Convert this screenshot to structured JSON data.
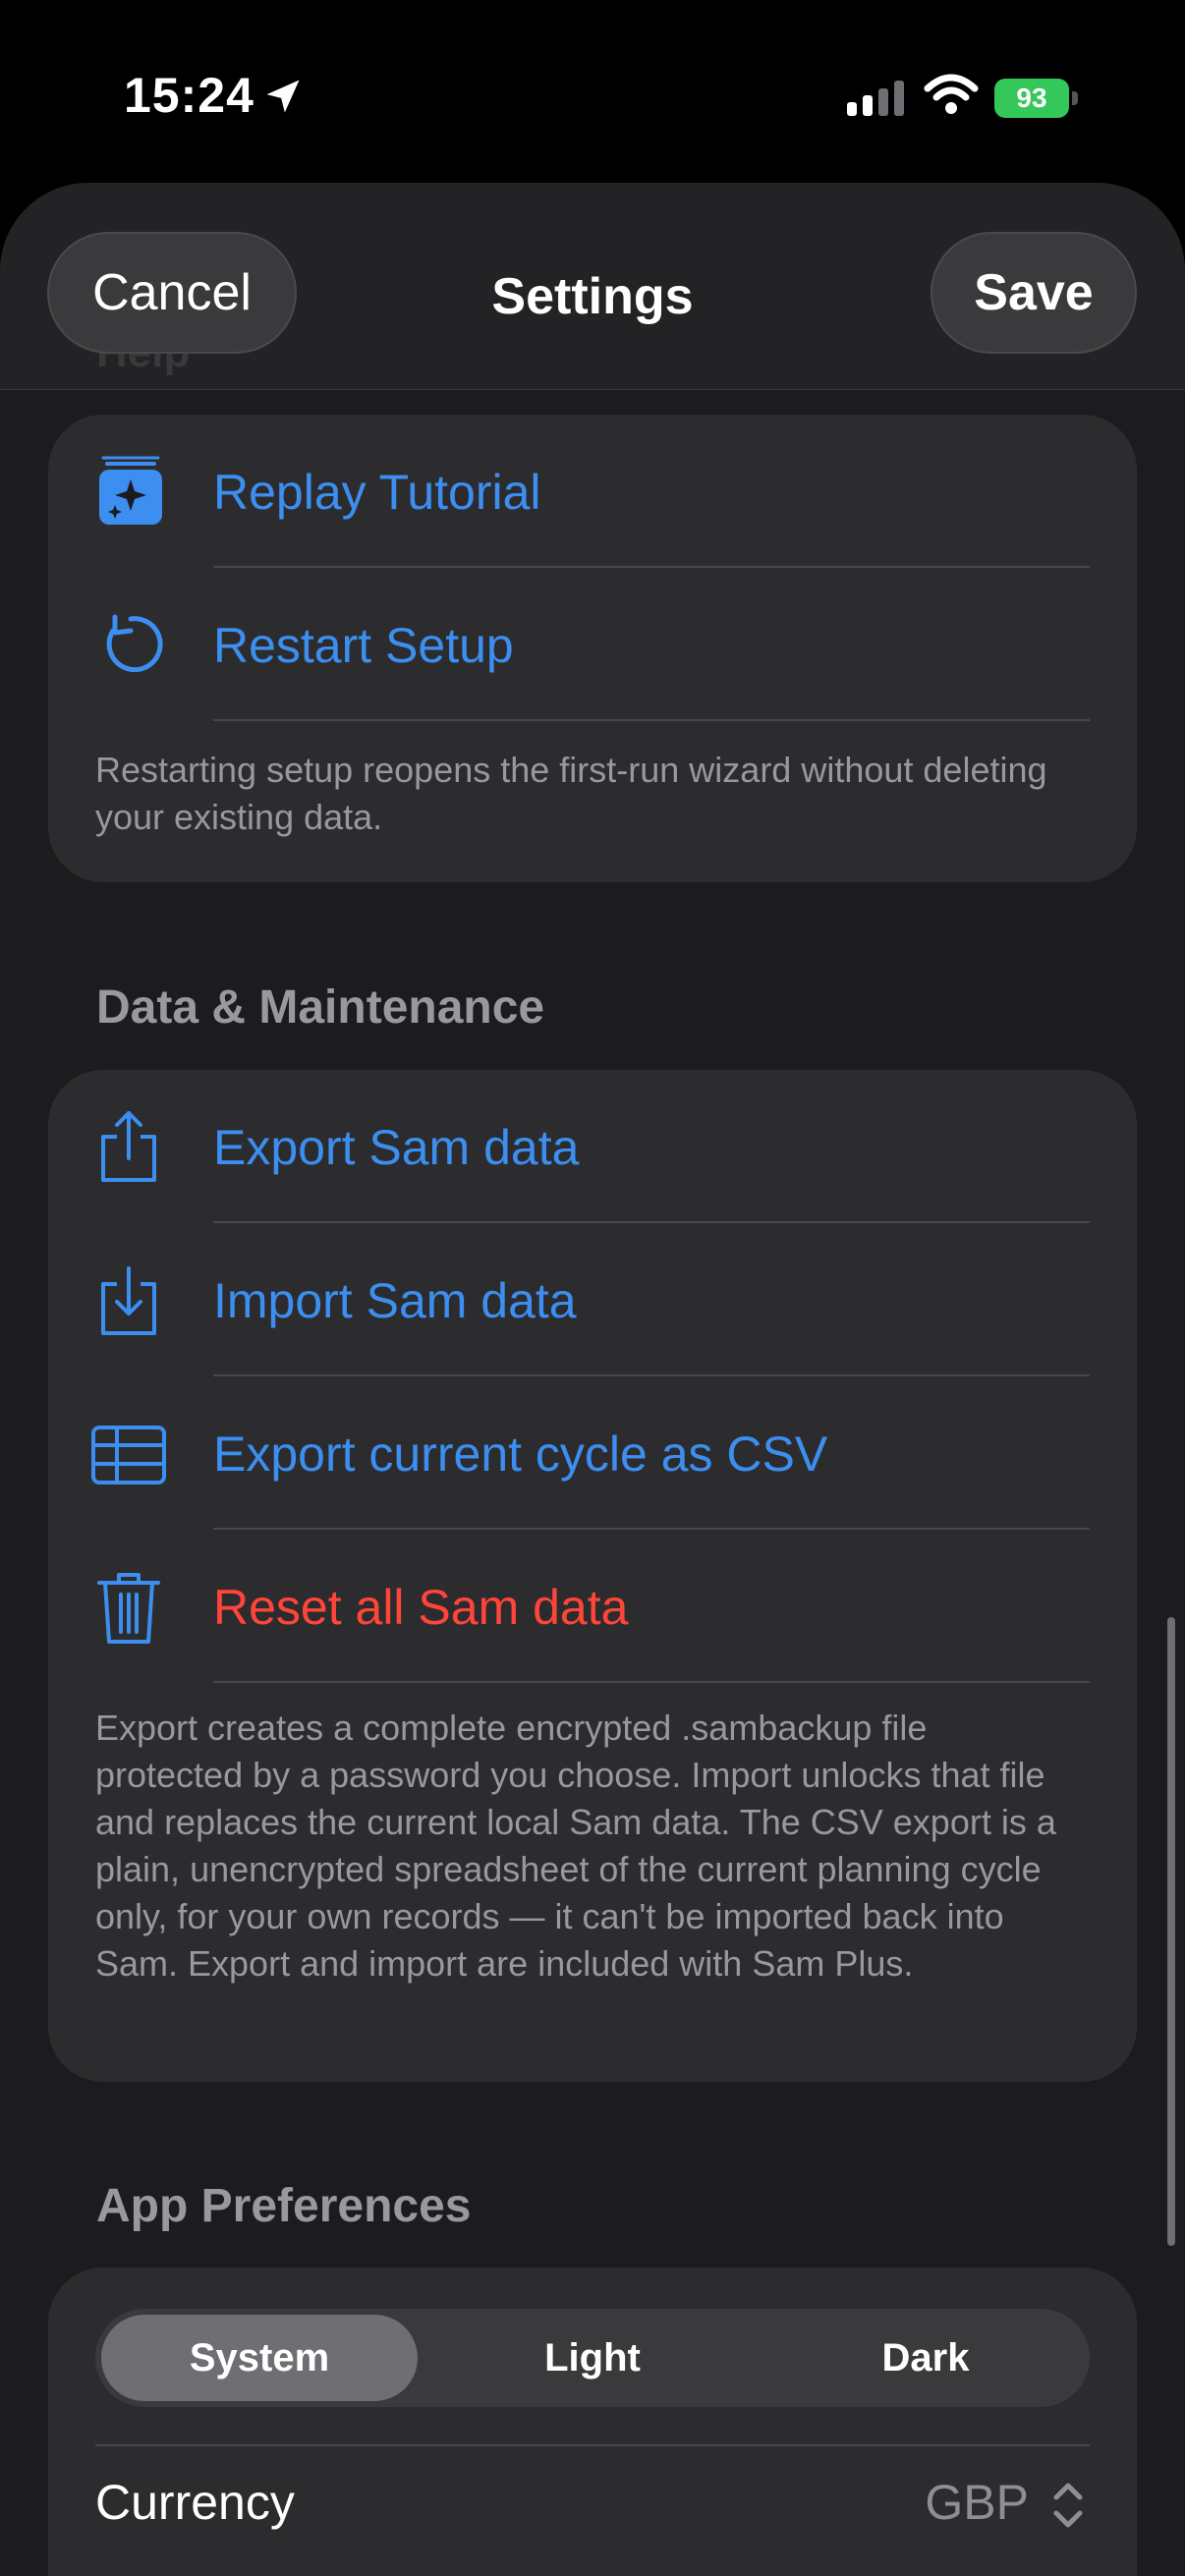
{
  "status_bar": {
    "time": "15:24",
    "battery": "93"
  },
  "nav": {
    "title": "Settings",
    "cancel_label": "Cancel",
    "save_label": "Save",
    "ghost_header": "Help"
  },
  "help_section": {
    "items": [
      {
        "label": "Replay Tutorial",
        "icon": "tutorial-sparkle-icon"
      },
      {
        "label": "Restart Setup",
        "icon": "restart-arrow-icon"
      }
    ],
    "footnote": "Restarting setup reopens the first-run wizard without deleting your existing data."
  },
  "data_section": {
    "header": "Data & Maintenance",
    "items": [
      {
        "label": "Export Sam data",
        "icon": "share-icon"
      },
      {
        "label": "Import Sam data",
        "icon": "import-icon"
      },
      {
        "label": "Export current cycle as CSV",
        "icon": "table-icon"
      },
      {
        "label": "Reset all Sam data",
        "icon": "trash-icon",
        "destructive": true
      }
    ],
    "footnote": "Export creates a complete encrypted .sambackup file protected by a password you choose. Import unlocks that file and replaces the current local Sam data. The CSV export is a plain, unencrypted spreadsheet of the current planning cycle only, for your own records — it can't be imported back into Sam. Export and import are included with Sam Plus."
  },
  "prefs_section": {
    "header": "App Preferences",
    "appearance_options": [
      "System",
      "Light",
      "Dark"
    ],
    "appearance_selected": "System",
    "currency_label": "Currency",
    "currency_value": "GBP"
  },
  "colors": {
    "accent": "#3c8ef0",
    "destructive": "#ff453a",
    "battery": "#34c759",
    "card": "#2c2c2e",
    "background": "#1c1c1e"
  }
}
